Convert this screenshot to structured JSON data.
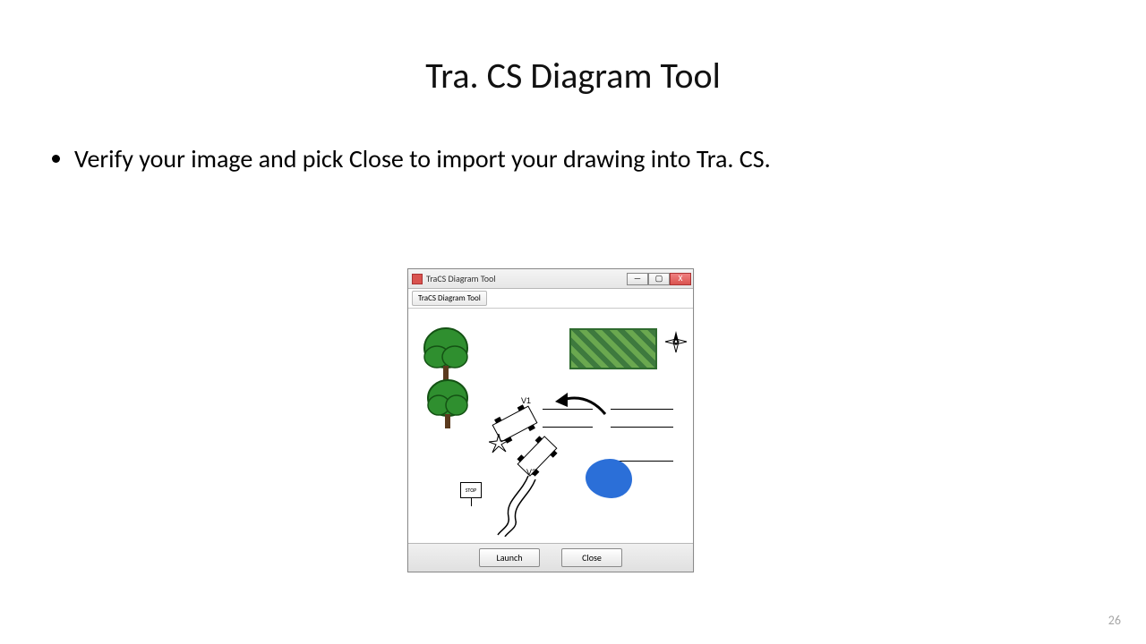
{
  "title": "Tra. CS Diagram Tool",
  "bullet": "Verify your image and pick Close to import your drawing into Tra. CS.",
  "page_number": "26",
  "window": {
    "title": "TraCS Diagram Tool",
    "toolbar_button": "TraCS Diagram Tool",
    "buttons": {
      "minimize": "—",
      "maximize": "▢",
      "close": "X",
      "launch": "Launch",
      "close_bottom": "Close"
    },
    "scene": {
      "v1_label": "V1",
      "v2_label": "V2",
      "sign_label": "STOP"
    }
  }
}
